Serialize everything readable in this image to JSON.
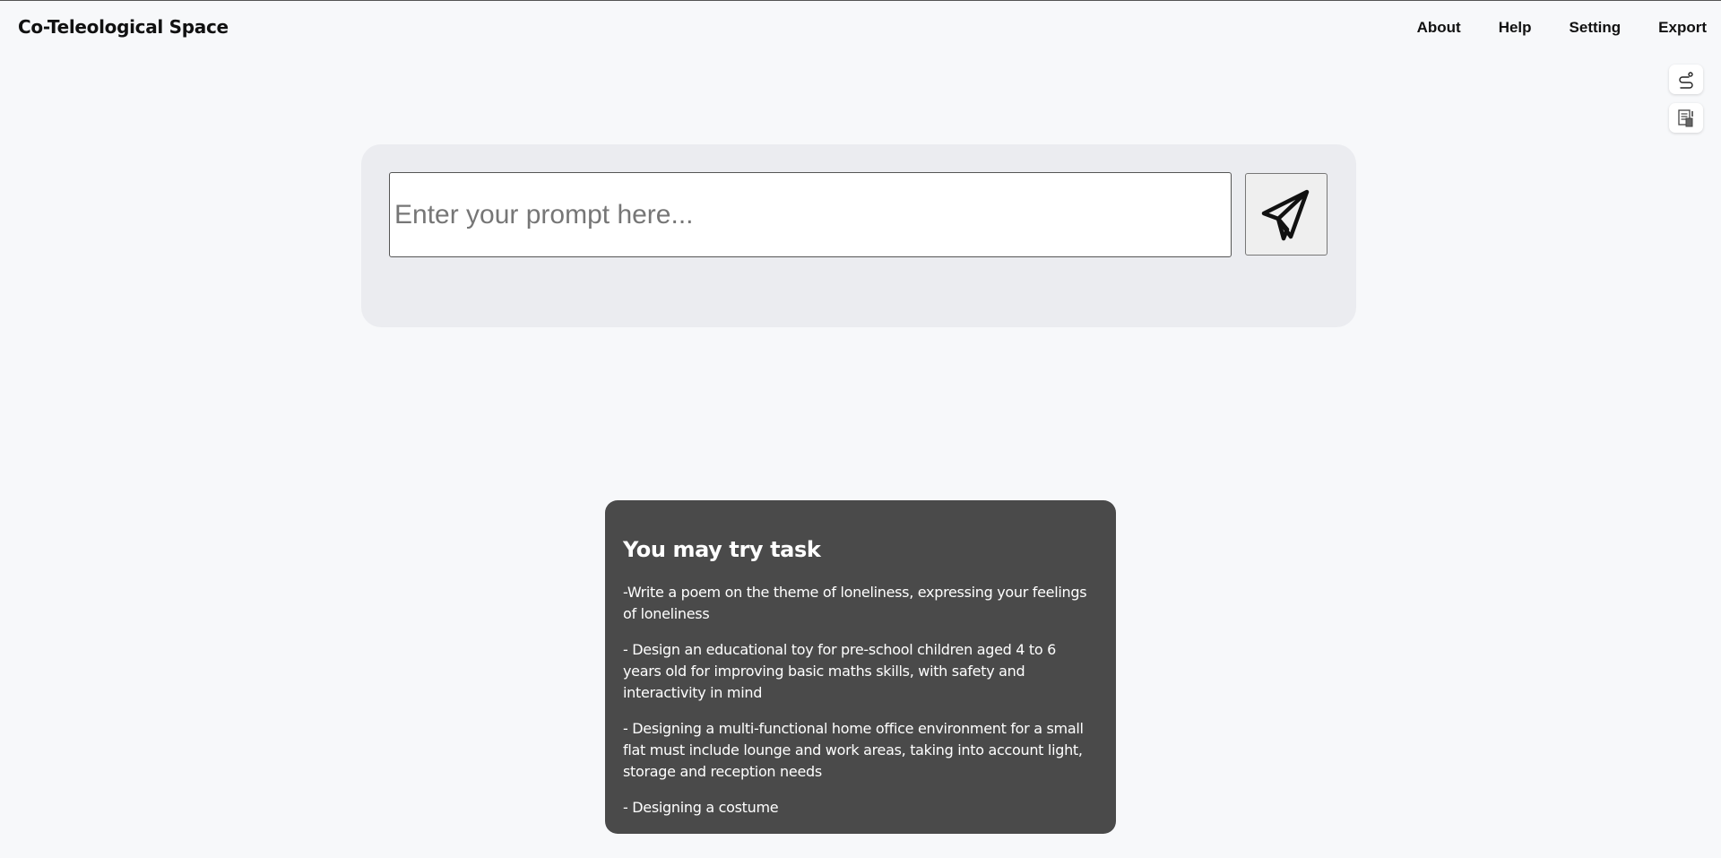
{
  "header": {
    "title": "Co-Teleological Space",
    "nav": [
      "About",
      "Help",
      "Setting",
      "Export"
    ]
  },
  "side_buttons": [
    {
      "icon": "route-icon"
    },
    {
      "icon": "document-clip-icon"
    }
  ],
  "prompt": {
    "placeholder": "Enter your prompt here...",
    "value": "",
    "send_icon": "paper-plane-icon"
  },
  "task_card": {
    "title": "You may try task",
    "items": [
      "-Write a poem on the theme of loneliness, expressing your feelings of loneliness",
      "- Design an educational toy for pre-school children aged 4 to 6 years old for improving basic maths skills, with safety and interactivity in mind",
      "- Designing a multi-functional home office environment for a small flat must include lounge and work areas, taking into account light, storage and reception needs",
      "- Designing a costume"
    ]
  },
  "colors": {
    "background": "#f7f8fa",
    "prompt_panel": "#ebecf0",
    "task_card": "#4a4a4a",
    "text": "#111111"
  }
}
